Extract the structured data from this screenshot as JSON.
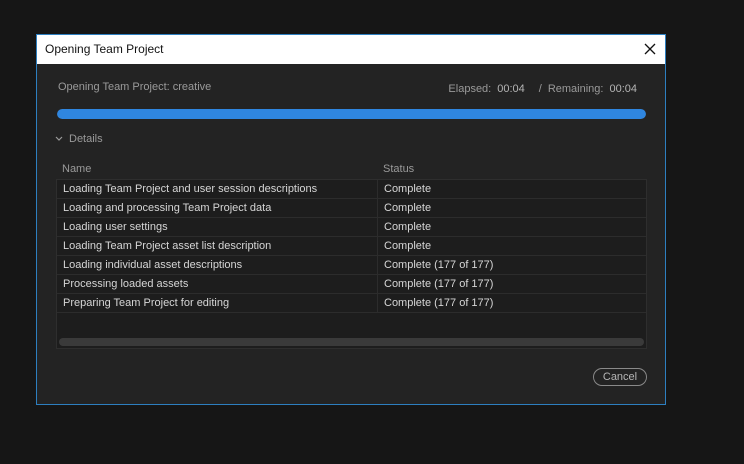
{
  "window": {
    "title": "Opening Team Project"
  },
  "header": {
    "status_text": "Opening Team Project: creative",
    "elapsed_label": "Elapsed:",
    "elapsed_value": "00:04",
    "separator": "/",
    "remaining_label": "Remaining:",
    "remaining_value": "00:04"
  },
  "progress": {
    "value": 1.0,
    "color": "#2f86e0"
  },
  "details": {
    "toggle_label": "Details",
    "expanded": true
  },
  "table": {
    "columns": [
      "Name",
      "Status"
    ],
    "rows": [
      {
        "name": "Loading Team Project and user session descriptions",
        "status": "Complete"
      },
      {
        "name": "Loading and processing Team Project data",
        "status": "Complete"
      },
      {
        "name": "Loading user settings",
        "status": "Complete"
      },
      {
        "name": "Loading Team Project asset list description",
        "status": "Complete"
      },
      {
        "name": "Loading individual asset descriptions",
        "status": "Complete (177 of 177)"
      },
      {
        "name": "Processing loaded assets",
        "status": "Complete (177 of 177)"
      },
      {
        "name": "Preparing Team Project for editing",
        "status": "Complete (177 of 177)"
      }
    ]
  },
  "footer": {
    "cancel_label": "Cancel"
  },
  "icons": {
    "close": "close-icon",
    "chevron": "chevron-down-icon"
  }
}
